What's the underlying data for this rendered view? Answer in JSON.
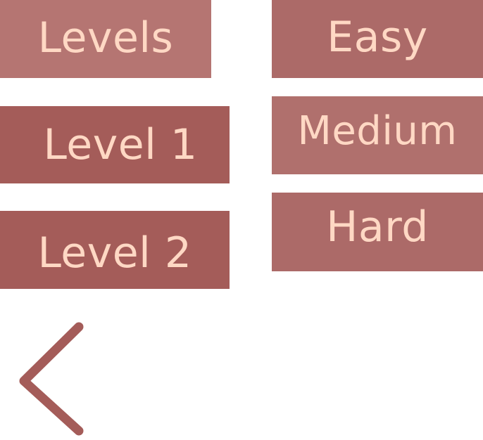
{
  "menu": {
    "header_label": "Levels",
    "levels": [
      {
        "label": "Level 1"
      },
      {
        "label": "Level 2"
      }
    ],
    "difficulties": [
      {
        "label": "Easy"
      },
      {
        "label": "Medium"
      },
      {
        "label": "Hard"
      }
    ]
  },
  "back": {
    "icon": "chevron-left-icon"
  },
  "colors": {
    "header_bg": "#b57572",
    "level_bg": "#a45c59",
    "difficulty_bg": "#ac6a68",
    "text": "#ffd8c4",
    "chevron": "#a45c59"
  }
}
